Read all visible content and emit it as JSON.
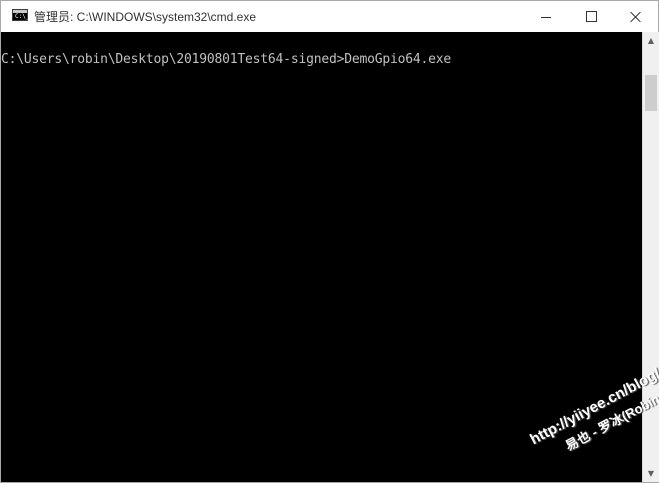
{
  "window": {
    "title": "管理员: C:\\WINDOWS\\system32\\cmd.exe",
    "app_icon_text": "C:\\_",
    "controls": {
      "minimize": "minimize",
      "maximize": "maximize",
      "close": "close"
    }
  },
  "console": {
    "lines": [
      "C:\\Users\\robin\\Desktop\\20190801Test64-signed>DemoGpio64.exe"
    ]
  },
  "scrollbar": {
    "up_glyph": "▲",
    "down_glyph": "▼"
  },
  "watermark": {
    "line1": "http://yiiyee.cn/blog/",
    "line2": "易也 - 罗冰(Robin)"
  },
  "colors": {
    "console_bg": "#000000",
    "console_text": "#c0c0c0",
    "titlebar_bg": "#ffffff"
  }
}
